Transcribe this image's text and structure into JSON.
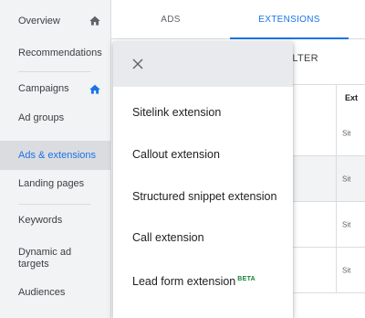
{
  "sidebar": {
    "items": [
      {
        "label": "Overview",
        "icon": "home-icon"
      },
      {
        "label": "Recommendations"
      },
      {
        "label": "Campaigns",
        "icon": "home-icon"
      },
      {
        "label": "Ad groups"
      },
      {
        "label": "Ads & extensions",
        "active": true
      },
      {
        "label": "Landing pages"
      },
      {
        "label": "Keywords"
      },
      {
        "label": "Dynamic ad targets"
      },
      {
        "label": "Audiences"
      }
    ]
  },
  "tabs": [
    {
      "label": "ADS"
    },
    {
      "label": "EXTENSIONS",
      "active": true
    }
  ],
  "toolbar": {
    "filter_label": "FILTER"
  },
  "table": {
    "header": "Ext",
    "rows": [
      "Sit",
      "Sit",
      "Sit",
      "Sit"
    ]
  },
  "menu": {
    "items": [
      {
        "label": "Sitelink extension"
      },
      {
        "label": "Callout extension"
      },
      {
        "label": "Structured snippet extension"
      },
      {
        "label": "Call extension"
      },
      {
        "label": "Lead form extension",
        "badge": "BETA"
      }
    ]
  },
  "colors": {
    "accent": "#1a73e8",
    "beta": "#188038",
    "sidebar_bg": "#f1f3f4"
  }
}
